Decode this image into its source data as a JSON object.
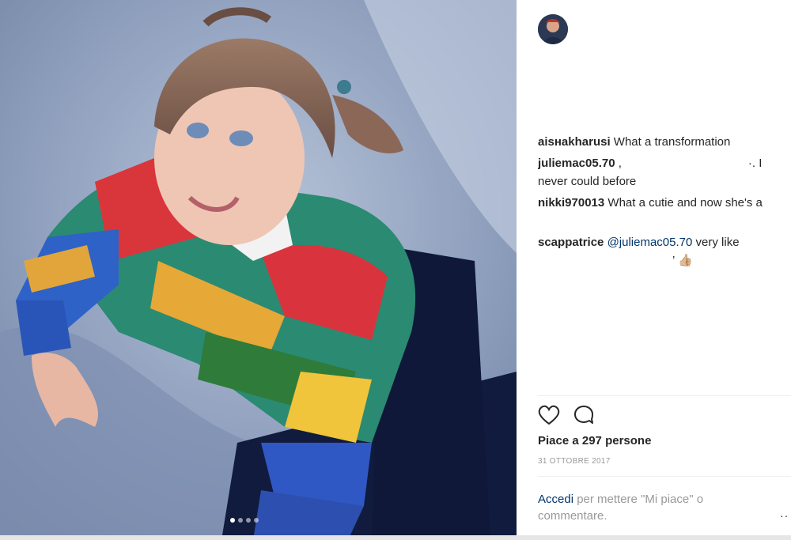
{
  "post": {
    "likes_text": "Piace a 297 persone",
    "date": "31 OTTOBRE 2017",
    "carousel": {
      "count": 4,
      "active_index": 0
    }
  },
  "comments": [
    {
      "user": "aisнakharusi",
      "text": " What a transformation"
    },
    {
      "user": "juliemac05.70",
      "text_a": " ,",
      "text_b": "·. I",
      "text_c": "never could before"
    },
    {
      "user": "nikki970013",
      "text": " What a cutie and now she's a"
    },
    {
      "user": "scappatrice",
      "mention": "@juliemac05.70",
      "text": " very like",
      "text_c": "’ 👍🏼"
    }
  ],
  "login_prompt": {
    "link": "Accedi",
    "text": " per mettere \"Mi piace\" o commentare."
  },
  "more_label": "··",
  "icons": {
    "like": "heart-icon",
    "comment": "comment-bubble-icon"
  }
}
